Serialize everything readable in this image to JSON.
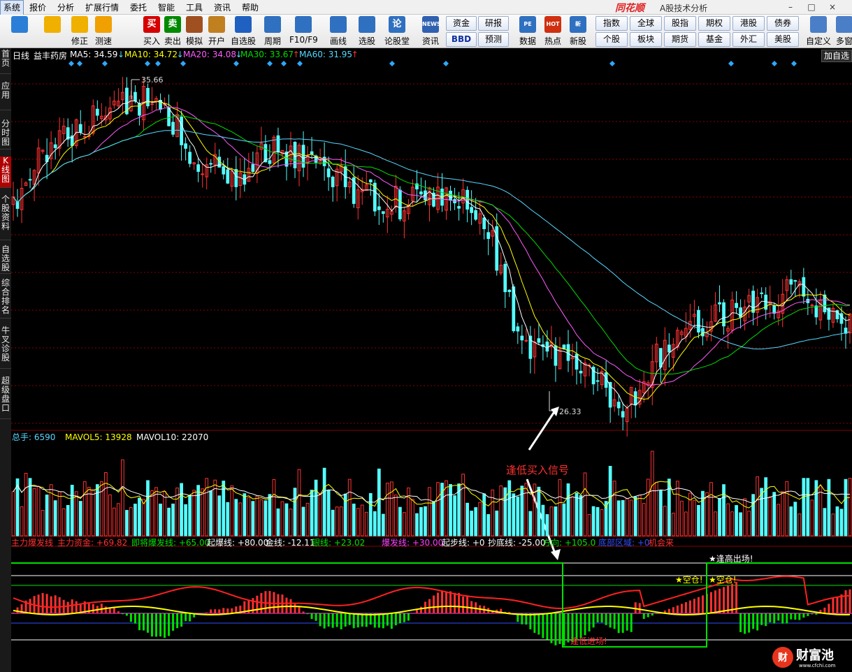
{
  "menubar": {
    "items": [
      "系统",
      "报价",
      "分析",
      "扩展行情",
      "委托",
      "智能",
      "工具",
      "资讯",
      "帮助"
    ],
    "brand": "同花顺",
    "subtitle": "A股技术分析"
  },
  "toolbar": {
    "buttons": [
      {
        "label": "",
        "icon": "layout-grid-icon",
        "color": "#2c7fd6"
      },
      {
        "label": "",
        "icon": "back-arrow-icon",
        "color": "#f0b000"
      },
      {
        "label": "修正",
        "icon": "up-down-arrows-icon",
        "color": "#f0b000"
      },
      {
        "label": "测速",
        "icon": "clock-icon",
        "color": "#f0a000"
      },
      {
        "label": "买入",
        "icon": "buy-icon",
        "color": "#d60000",
        "glyph": "买"
      },
      {
        "label": "卖出",
        "icon": "sell-icon",
        "color": "#008a00",
        "glyph": "卖"
      },
      {
        "label": "模拟",
        "icon": "hammer-icon",
        "color": "#a05020"
      },
      {
        "label": "开户",
        "icon": "lock-icon",
        "color": "#c08020"
      },
      {
        "label": "自选股",
        "icon": "star-icon",
        "color": "#2060c0"
      },
      {
        "label": "周期",
        "icon": "cycle-clock-icon",
        "color": "#3070c0"
      },
      {
        "label": "F10/F9",
        "icon": "f10-icon",
        "color": "#3070c0"
      },
      {
        "label": "画线",
        "icon": "pen-icon",
        "color": "#3070c0"
      },
      {
        "label": "选股",
        "icon": "stock-picker-icon",
        "color": "#3070c0"
      },
      {
        "label": "论股堂",
        "icon": "forum-icon",
        "color": "#3070c0",
        "glyph": "论"
      },
      {
        "label": "资讯",
        "icon": "news-icon",
        "color": "#3060b0",
        "glyph": "NEWS"
      }
    ],
    "small_buttons_a": [
      [
        "资金",
        "BBD"
      ],
      [
        "研报",
        "预测"
      ]
    ],
    "buttons_b": [
      {
        "label": "数据",
        "icon": "pe-icon",
        "glyph": "PE"
      },
      {
        "label": "热点",
        "icon": "hot-icon",
        "glyph": "HOT"
      },
      {
        "label": "新股",
        "icon": "new-stock-icon",
        "glyph": "新"
      }
    ],
    "small_buttons_b": [
      [
        "指数",
        "个股"
      ],
      [
        "全球",
        "板块"
      ],
      [
        "股指",
        "期货"
      ],
      [
        "期权",
        "基金"
      ],
      [
        "港股",
        "外汇"
      ],
      [
        "债券",
        "美股"
      ]
    ],
    "buttons_c": [
      {
        "label": "自定义",
        "icon": "customize-icon"
      },
      {
        "label": "多窗",
        "icon": "multi-window-icon"
      }
    ]
  },
  "leftnav": {
    "items": [
      "首页",
      "应用",
      "分时图",
      "K线图",
      "个股资料",
      "自选股",
      "综合排名",
      "牛叉诊股",
      "超级盘口"
    ],
    "active": 3
  },
  "stock_info": {
    "period": "日线",
    "name": "益丰药房",
    "ma": [
      {
        "label": "MA5: 34.59",
        "color": "#ffffff",
        "arrow": "down"
      },
      {
        "label": "MA10: 34.72",
        "color": "#ffff00",
        "arrow": "down"
      },
      {
        "label": "MA20: 34.08",
        "color": "#ff5cff",
        "arrow": "down"
      },
      {
        "label": "MA30: 33.67",
        "color": "#00dd00",
        "arrow": "up"
      },
      {
        "label": "MA60: 31.95",
        "color": "#55d8ff",
        "arrow": "up"
      }
    ],
    "add_watch": "加自选",
    "high_label": "35.66",
    "low_label": "26.33"
  },
  "volume_info": {
    "items": [
      {
        "label": "总手: 6590",
        "color": "#55d8ff",
        "arrow": "down"
      },
      {
        "label": "MAVOL5: 13928",
        "color": "#ffff00",
        "arrow": "down"
      },
      {
        "label": "MAVOL10: 22070",
        "color": "#ffffff",
        "arrow": "down"
      }
    ]
  },
  "indicator_info": {
    "items": [
      {
        "label": "主力爆发线",
        "color": "#ff3030"
      },
      {
        "label": "主力资金: +69.82",
        "color": "#ff3030",
        "arrow": "down"
      },
      {
        "label": "即将爆发线: +65.00",
        "color": "#00e000"
      },
      {
        "label": "起爆线: +80.00",
        "color": "#ffffff"
      },
      {
        "label": "金线: -12.11",
        "color": "#ffffff",
        "arrow": "down"
      },
      {
        "label": "银线: +23.02",
        "color": "#00e000",
        "arrow": "down"
      },
      {
        "label": "爆发线: +30.00",
        "color": "#ff40ff"
      },
      {
        "label": "起步线: +0",
        "color": "#ffffff"
      },
      {
        "label": "抄底线: -25.00",
        "color": "#ffffff"
      },
      {
        "label": "方向: +105.0",
        "color": "#00e000",
        "arrow": "down"
      },
      {
        "label": "底部区域: +0",
        "color": "#3050ff"
      },
      {
        "label": "机会来",
        "color": "#ff3030"
      }
    ]
  },
  "annotations": {
    "buy_signal": "逢低买入信号",
    "exit_high": "★逢高出场!",
    "empty_position": "★空仓!",
    "bottom_entry": "逢低进场!"
  },
  "watermark": {
    "text": "财富池",
    "url": "www.cfchi.com"
  },
  "colors": {
    "up": "#ff3232",
    "down": "#54ffff",
    "grid": "#8b0000",
    "ma5": "#ffffff",
    "ma10": "#ffff00",
    "ma20": "#ff5cff",
    "ma30": "#00dd00",
    "ma60": "#55d8ff"
  },
  "chart_data": {
    "type": "candlestick",
    "price_high": 35.66,
    "price_low": 26.33,
    "points": 200
  }
}
